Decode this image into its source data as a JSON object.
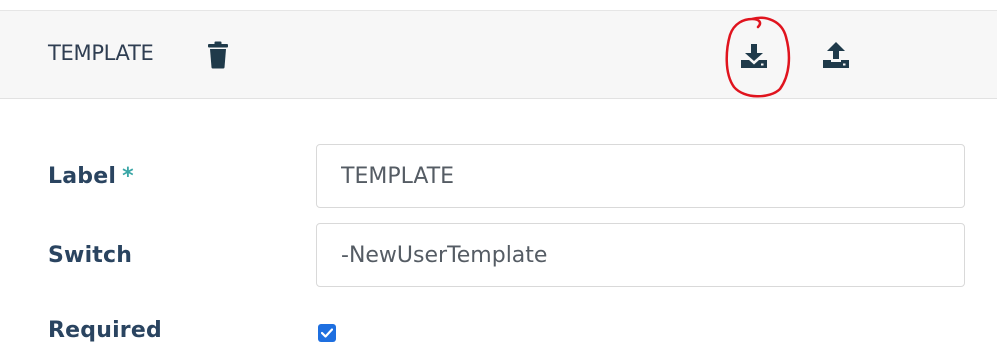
{
  "header": {
    "title": "TEMPLATE",
    "icons": {
      "delete": "trash-icon",
      "download": "download-icon",
      "upload": "upload-icon"
    }
  },
  "form": {
    "label_field": {
      "label": "Label",
      "required_mark": "*",
      "value": "TEMPLATE"
    },
    "switch_field": {
      "label": "Switch",
      "value": "-NewUserTemplate"
    },
    "required_field": {
      "label": "Required",
      "checked": true
    }
  },
  "colors": {
    "header_bg": "#f7f7f7",
    "label_text": "#2a4460",
    "icon": "#1f3a4a",
    "required_asterisk": "#3aa6a6",
    "checkbox": "#1e6fe0",
    "annotation_ring": "#e0141e"
  }
}
